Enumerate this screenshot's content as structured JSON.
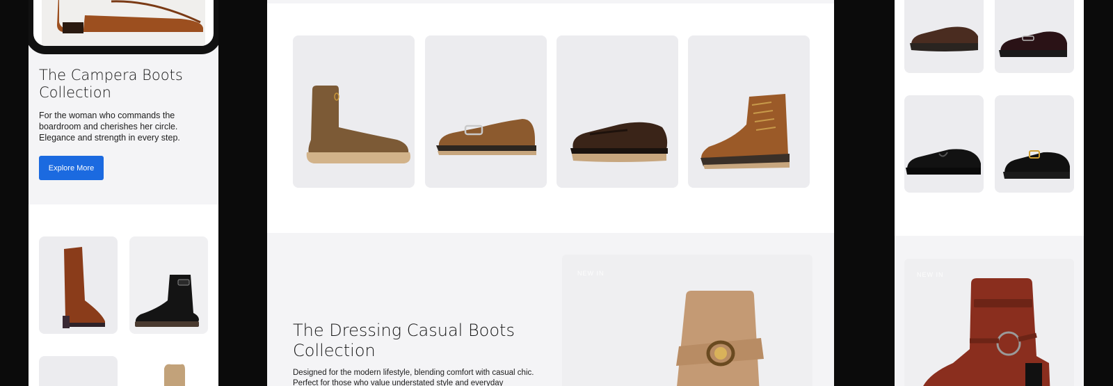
{
  "left_panel": {
    "title": "The Campera Boots Collection",
    "description": "For the woman who commands the boardroom and cherishes her circle. Elegance and strength in every step.",
    "cta_label": "Explore More"
  },
  "center_panel": {
    "title": "The Dressing Casual Boots Collection",
    "description": "Designed for the modern lifestyle, blending comfort with casual chic. Perfect for those who value understated style and everyday",
    "feature_tag": "NEW IN"
  },
  "right_panel": {
    "feature_tag": "NEW IN"
  },
  "colors": {
    "accent": "#1b6ae0",
    "background": "#0b0b0b",
    "panel": "#f4f4f6"
  }
}
